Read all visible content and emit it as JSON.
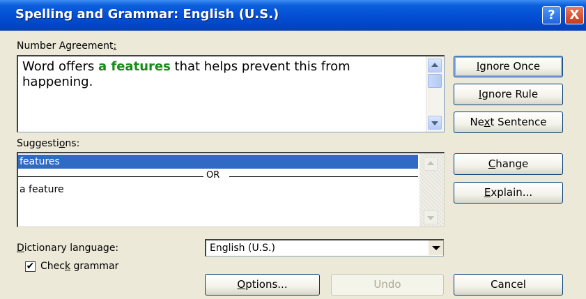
{
  "title_bar": {
    "title": "Spelling and Grammar: English (U.S.)",
    "help_label": "?",
    "close_label": "X"
  },
  "error_section": {
    "label_prefix": "Number Agreement",
    "label_key": ":",
    "text_before": "Word offers ",
    "text_highlight": "a features",
    "text_after": " that helps prevent this from happening.",
    "highlight_color": "#1a8a1a"
  },
  "suggestions_section": {
    "label_prefix": "Suggesti",
    "label_key": "o",
    "label_suffix": "ns:",
    "selected_item": "features",
    "separator": "OR",
    "other_item": "a feature"
  },
  "side_buttons": {
    "ignore_once": {
      "pre": "",
      "key": "I",
      "post": "gnore Once"
    },
    "ignore_rule": {
      "pre": "",
      "key": "I",
      "post": "gnore Rule"
    },
    "next_sentence": {
      "pre": "Ne",
      "key": "x",
      "post": "t Sentence"
    },
    "change": {
      "pre": "",
      "key": "C",
      "post": "hange"
    },
    "explain": {
      "pre": "",
      "key": "E",
      "post": "xplain..."
    }
  },
  "dictionary": {
    "label_key": "D",
    "label_rest": "ictionary language:",
    "selected": "English (U.S.)"
  },
  "check_grammar": {
    "label_pre": "Chec",
    "label_key": "k",
    "label_post": " grammar",
    "checked_mark": "✔"
  },
  "bottom_buttons": {
    "options": {
      "key": "O",
      "post": "ptions..."
    },
    "undo": "Undo",
    "cancel": "Cancel"
  },
  "colors": {
    "titlebar": "#0550d6",
    "selection": "#316ac5",
    "dialog_bg": "#ece9d8"
  }
}
